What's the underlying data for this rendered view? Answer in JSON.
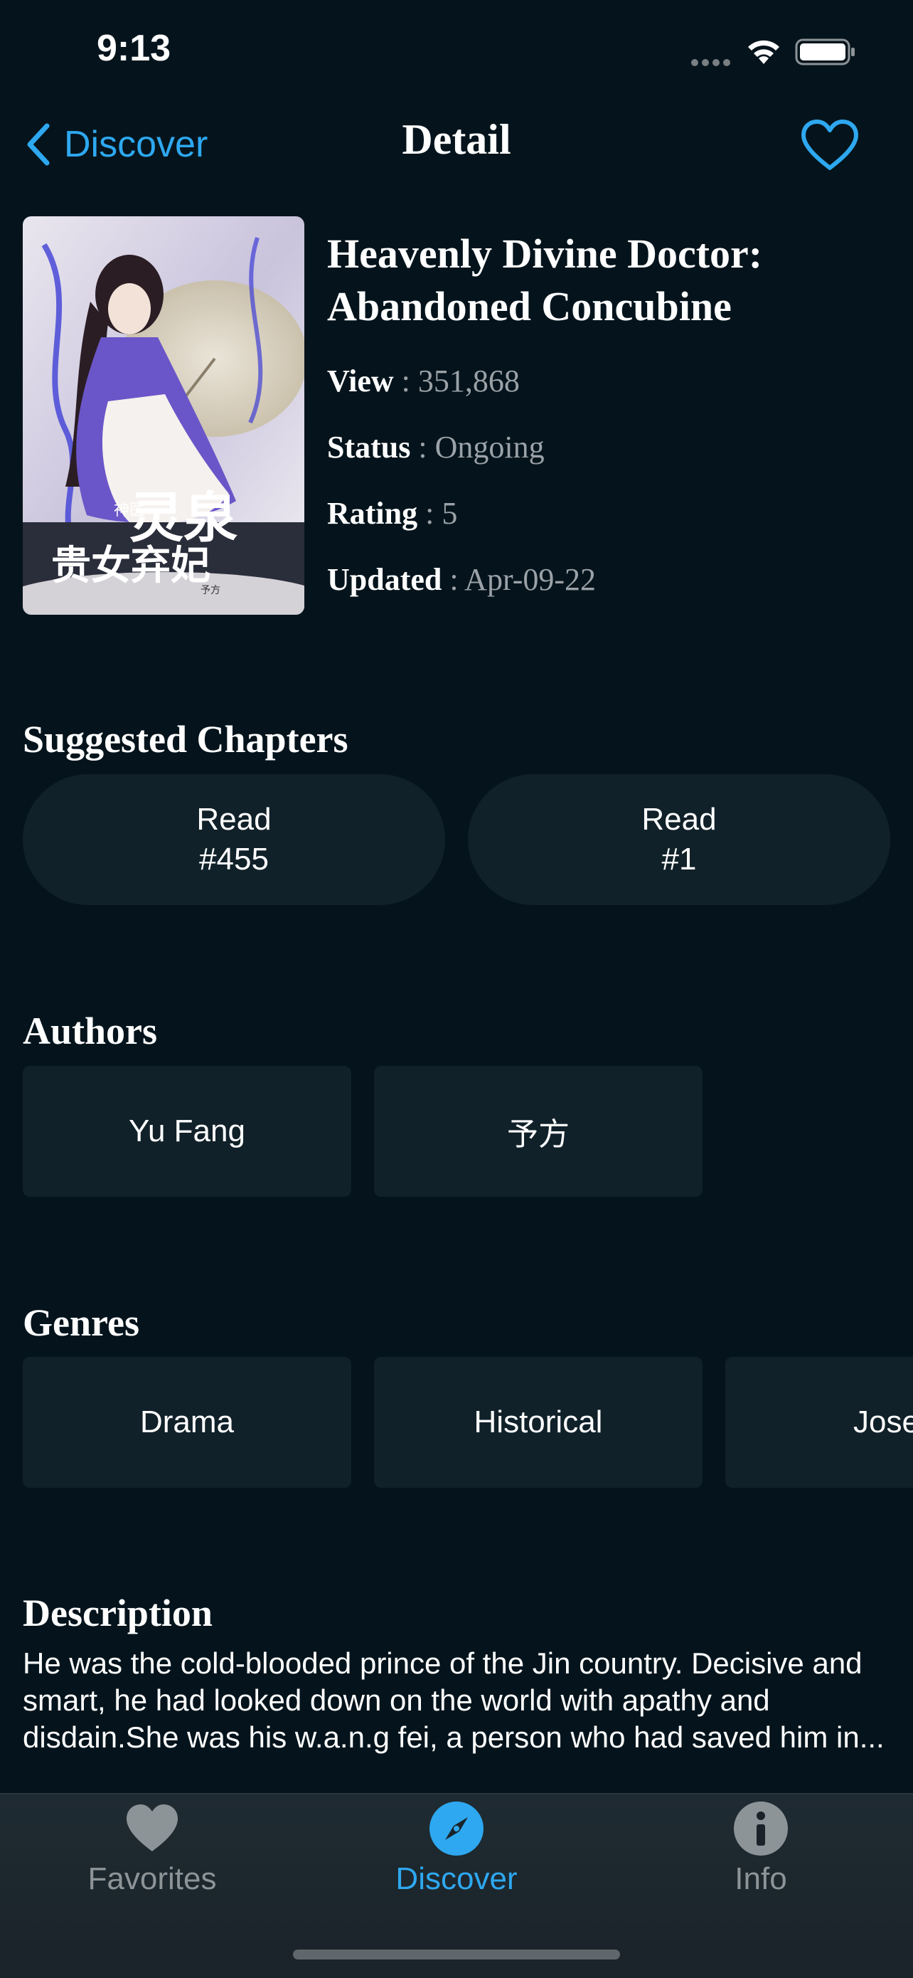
{
  "status_bar": {
    "time": "9:13"
  },
  "nav": {
    "back_label": "Discover",
    "title": "Detail",
    "accent_color": "#2ea8f0"
  },
  "book": {
    "title": "Heavenly Divine Doctor: Abandoned Concubine",
    "cover_text": {
      "main": "灵泉",
      "small": "神医",
      "bottom": "贵女弃妃",
      "author_mark": "予方"
    },
    "info": [
      {
        "label": "View",
        "value": "351,868"
      },
      {
        "label": "Status",
        "value": "Ongoing"
      },
      {
        "label": "Rating",
        "value": "5"
      },
      {
        "label": "Updated",
        "value": "Apr-09-22"
      }
    ],
    "separator": " : "
  },
  "suggested": {
    "heading": "Suggested Chapters",
    "chapters": [
      {
        "line1": "Read",
        "line2": "#455"
      },
      {
        "line1": "Read",
        "line2": "#1"
      }
    ]
  },
  "authors": {
    "heading": "Authors",
    "items": [
      "Yu Fang",
      "予方"
    ]
  },
  "genres": {
    "heading": "Genres",
    "items": [
      "Drama",
      "Historical",
      "Jose"
    ]
  },
  "description": {
    "heading": "Description",
    "text": "He was the cold-blooded prince of the Jin country. Decisive and smart, he had looked down on the world with apathy and disdain.She was his w.a.n.g fei, a person who had saved him in..."
  },
  "tabs": [
    {
      "label": "Favorites",
      "icon": "heart-icon",
      "active": false
    },
    {
      "label": "Discover",
      "icon": "compass-icon",
      "active": true
    },
    {
      "label": "Info",
      "icon": "info-icon",
      "active": false
    }
  ]
}
